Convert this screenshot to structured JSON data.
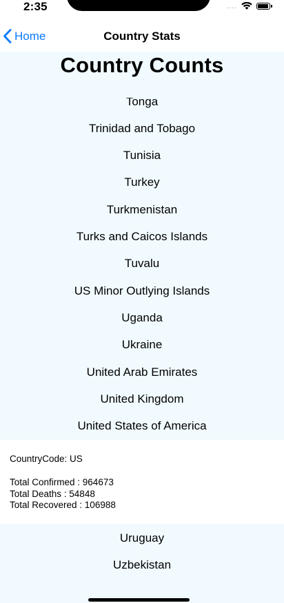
{
  "status_bar": {
    "time": "2:35",
    "signal": "....",
    "wifi_icon": "wifi-icon",
    "battery_icon": "battery-icon"
  },
  "nav": {
    "back_label": "Home",
    "title": "Country Stats"
  },
  "page": {
    "title": "Country Counts"
  },
  "countries_top": [
    "Tonga",
    "Trinidad and Tobago",
    "Tunisia",
    "Turkey",
    "Turkmenistan",
    "Turks and Caicos Islands",
    "Tuvalu",
    "US Minor Outlying Islands",
    "Uganda",
    "Ukraine",
    "United Arab Emirates",
    "United Kingdom",
    "United States of America"
  ],
  "details": {
    "country_code": "CountryCode: US",
    "total_confirmed": "Total Confirmed : 964673",
    "total_deaths": "Total Deaths : 54848",
    "total_recovered": "Total Recovered : 106988"
  },
  "countries_bottom": [
    "Uruguay",
    "Uzbekistan"
  ],
  "colors": {
    "accent": "#0a7aff",
    "list_background": "#f1fbff"
  }
}
